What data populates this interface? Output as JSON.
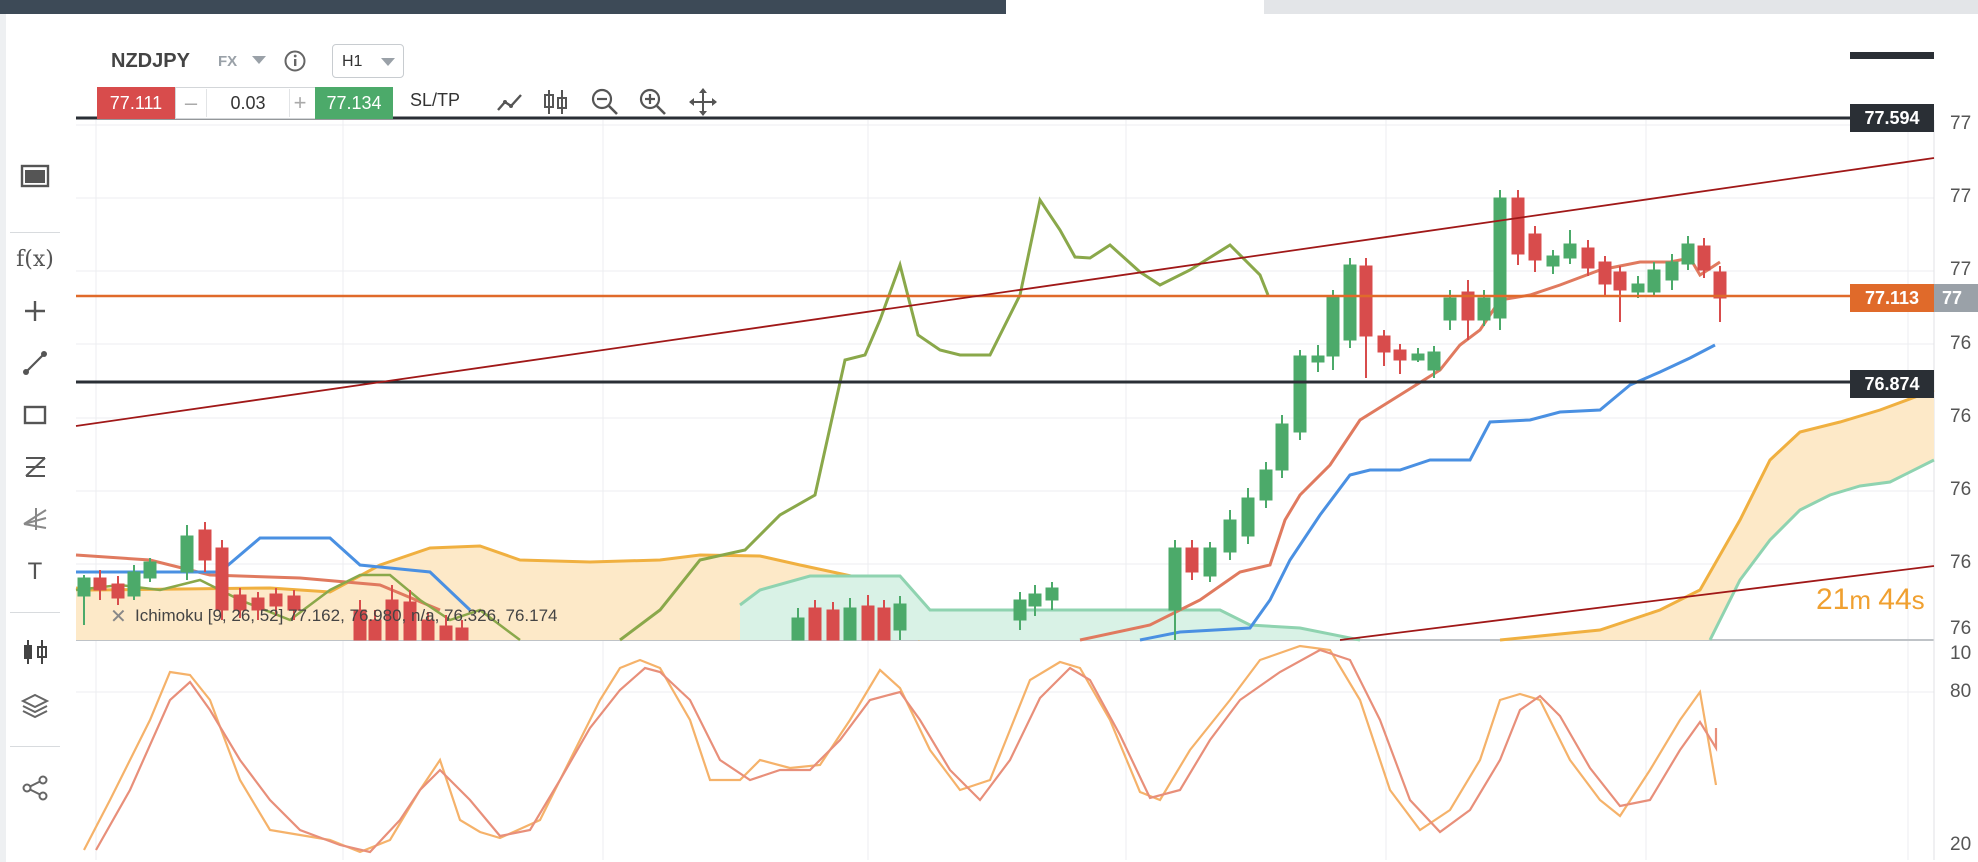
{
  "header": {
    "symbol": "NZDJPY",
    "type": "FX",
    "timeframe": "H1"
  },
  "trade": {
    "sell_price": "77.111",
    "minus": "–",
    "quantity": "0.03",
    "plus": "+",
    "buy_price": "77.134",
    "sltp": "SL/TP"
  },
  "toolbar": {
    "icons": [
      "line-chart-icon",
      "candles-icon",
      "zoom-out-icon",
      "zoom-in-icon",
      "pan-icon"
    ]
  },
  "sidebar": {
    "fx_label": "f(x)",
    "text_label": "T"
  },
  "price_labels": {
    "top_line": "77.594",
    "current": "77.113",
    "mid_line": "76.874",
    "current_axis": "77"
  },
  "axis": {
    "price_ticks": [
      "77",
      "77",
      "77",
      "76",
      "76",
      "76",
      "76",
      "76"
    ],
    "stoch_ticks": [
      "10",
      "80",
      "20"
    ]
  },
  "indicator": {
    "legend": "Ichimoku [9, 26, 52] 77.162, 76.980, n/a, 76.326, 76.174"
  },
  "countdown": {
    "minutes": "21",
    "m": "m",
    "seconds": "44",
    "s": "s"
  },
  "colors": {
    "sell": "#d84c4c",
    "buy": "#4caa6a",
    "bull": "#4caa6a",
    "bear": "#d84c4c",
    "tenkan": "#e07a5f",
    "kijun": "#4a90e2",
    "chikou": "#8aa84a",
    "cloud_orange": "#f0b040",
    "cloud_green": "#8fd3b0",
    "trendline": "#a01818",
    "current_price": "#e06a2a",
    "hline": "#2a2f35"
  }
}
